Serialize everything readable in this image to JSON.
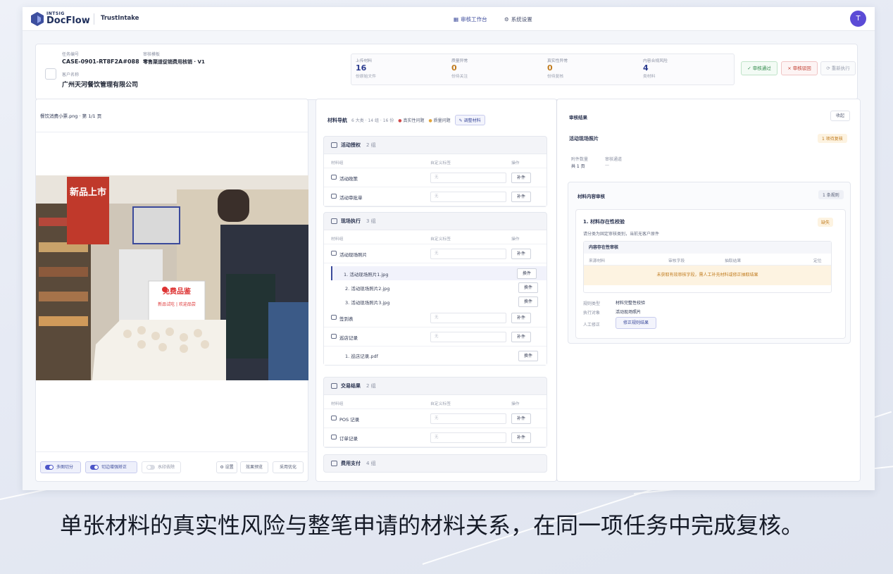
{
  "brand": {
    "small": "INTSIG",
    "name": "DocFlow",
    "app": "TrustIntake"
  },
  "nav": [
    {
      "label": "审核工作台",
      "active": true
    },
    {
      "label": "系统设置",
      "active": false
    }
  ],
  "user": {
    "initial": "T"
  },
  "case": {
    "task_label": "任务编号",
    "task_no": "CASE-0901-RT8F2A#088",
    "tpl_label": "审核模板",
    "tpl_value": "零售渠道促销费用核销 · V1",
    "client_label": "客户名称",
    "client_value": "广州天河餐饮管理有限公司"
  },
  "stats": [
    {
      "title": "上传材料",
      "value": "16",
      "sub": "份原始文件"
    },
    {
      "title": "质量异常",
      "value": "0",
      "sub": "份待关注"
    },
    {
      "title": "真实性异常",
      "value": "0",
      "sub": "份待复核"
    },
    {
      "title": "内容合规风险",
      "value": "4",
      "sub": "类材料"
    }
  ],
  "actions": {
    "approve": "✓ 审核通过",
    "reject": "× 审核驳回",
    "rerun": "⟳ 重新执行"
  },
  "preview": {
    "file": "餐饮消费小票.png · 第 1/1 页",
    "poster": "新品上市",
    "sign_main": "免费品鉴",
    "sign_sub": "新品试吃 | 欢迎品尝"
  },
  "controls": {
    "t1": "多图切分",
    "t2": "切边增强矫正",
    "t3": "水印去除",
    "b1": "⚙ 设置",
    "b2": "效果预览",
    "b3": "采用优化"
  },
  "materials": {
    "title": "材料导航",
    "summary": "6 大类 · 14 组 · 16 份",
    "legend1": "真实性问题",
    "legend2": "质量问题",
    "adjust": "✎ 调整材料",
    "col_group": "材料组",
    "col_custom": "自定义标签",
    "col_op": "操作",
    "placeholder": "无",
    "add": "补件",
    "swap": "换件",
    "sections": [
      {
        "name": "活动授权",
        "count": "2 组",
        "rows": [
          "活动政策",
          "活动审批单"
        ]
      },
      {
        "name": "现场执行",
        "count": "3 组",
        "rows": [
          "活动现场照片",
          "签到表",
          "巡店记录"
        ],
        "files": [
          "1. 活动现场照片1.jpg",
          "2. 活动现场照片2.jpg",
          "3. 活动现场照片3.jpg"
        ],
        "file2": "1. 巡店记录.pdf"
      },
      {
        "name": "交易结果",
        "count": "2 组",
        "rows": [
          "POS 记录",
          "订单记录"
        ]
      },
      {
        "name": "费用支付",
        "count": "4 组"
      }
    ]
  },
  "result": {
    "title": "审核结果",
    "collapse": "收起",
    "item": "活动现场照片",
    "item_badge": "1 项待复核",
    "count_label": "附件数量",
    "count_value": "共 1 页",
    "channel_label": "审核通道",
    "channel_value": "—",
    "content_title": "材料内容审核",
    "content_badge": "1 条规则",
    "rule_title": "1. 材料存在性校验",
    "rule_badge": "缺失",
    "rule_desc": "请分类为固定审核类别，当前无客户原件",
    "table_title": "内容存在性审核",
    "th": [
      "来源材料",
      "审核字段",
      "抽取结果",
      "定位"
    ],
    "notice": "未获取有效审核字段，需人工补充材料或修正抽取结果",
    "k1": "规则类型",
    "v1": "材料完整性校验",
    "k2": "执行对象",
    "v2": "活动现场照片",
    "k3": "人工修正",
    "fix": "修正规则结果"
  },
  "caption": "单张材料的真实性风险与整笔申请的材料关系，在同一项任务中完成复核。",
  "colors": {
    "accent": "#3b4a9b",
    "avatar": "#5b4bd6",
    "warn_bg": "#fdf3e1",
    "warn_text": "#c07b1d"
  }
}
